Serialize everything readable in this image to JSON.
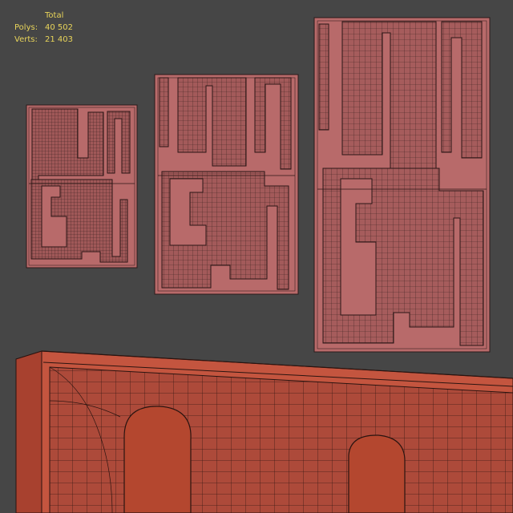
{
  "stats": {
    "header": "Total",
    "polys_label": "Polys:",
    "polys_value": "40 502",
    "verts_label": "Verts:",
    "verts_value": "21 403"
  },
  "colors": {
    "background": "#464646",
    "stats_text": "#e8d45a",
    "mesh_fill": "#b86a6a",
    "mesh_recess": "#9f5555",
    "mesh_closeup": "#b04b3b",
    "wire": "#3b2220"
  }
}
